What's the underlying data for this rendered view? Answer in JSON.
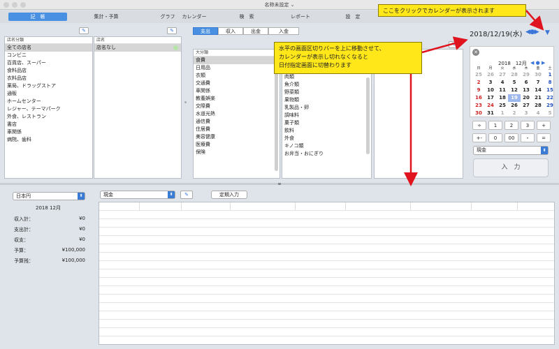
{
  "window": {
    "title": "名称未設定 ⌄"
  },
  "tabs": [
    {
      "label": "記　帳",
      "active": true
    },
    {
      "label": "集計・予算"
    },
    {
      "label": "グラフ"
    },
    {
      "label": "カレンダー"
    },
    {
      "label": "検　索"
    },
    {
      "label": "レポート"
    },
    {
      "label": "設　定"
    }
  ],
  "stores": {
    "header_left": "店名分類",
    "header_right": "店名",
    "categories": [
      "全ての店名",
      "コンビニ",
      "百貨店、スーパー",
      "食料品店",
      "衣料品店",
      "薬局、ドラッグストア",
      "通販",
      "ホームセンター",
      "レジャー、テーマパーク",
      "外食、レストラン",
      "書店",
      "車関係",
      "病院、歯科"
    ],
    "selected_store": "店名なし"
  },
  "entry_types": [
    "支出",
    "収入",
    "出金",
    "入金"
  ],
  "major": {
    "header": "大分類",
    "items": [
      "食費",
      "日用品",
      "衣類",
      "交通費",
      "車関係",
      "教養娯楽",
      "交際費",
      "水道光熱",
      "通信費",
      "住居費",
      "美容健康",
      "医療費",
      "保険"
    ]
  },
  "minor": {
    "items": [
      "肉類",
      "魚介類",
      "野菜類",
      "果物類",
      "乳製品・卵",
      "調味料",
      "菓子類",
      "飲料",
      "外食",
      "キノコ類",
      "お弁当・おにぎり"
    ]
  },
  "date": {
    "display": "2018/12/19(水)"
  },
  "calendar": {
    "year_month": "2018　12月",
    "weekdays": [
      "日",
      "月",
      "火",
      "水",
      "木",
      "金",
      "土"
    ],
    "weeks": [
      [
        "25",
        "26",
        "27",
        "28",
        "29",
        "30",
        "1"
      ],
      [
        "2",
        "3",
        "4",
        "5",
        "6",
        "7",
        "8"
      ],
      [
        "9",
        "10",
        "11",
        "12",
        "13",
        "14",
        "15"
      ],
      [
        "16",
        "17",
        "18",
        "19",
        "20",
        "21",
        "22"
      ],
      [
        "23",
        "24",
        "25",
        "26",
        "27",
        "28",
        "29"
      ],
      [
        "30",
        "31",
        "1",
        "2",
        "3",
        "4",
        "5"
      ]
    ]
  },
  "keypad": {
    "rows": [
      [
        "÷",
        "1",
        "2",
        "3",
        "+"
      ],
      [
        "+-",
        "0",
        "00",
        "・",
        "="
      ]
    ]
  },
  "payment": {
    "selected": "現金"
  },
  "input_button": "入　力",
  "bottom": {
    "currency": "日本円",
    "account": "現金",
    "fixed_button": "定期入力",
    "month": "2018 12月",
    "summary": [
      {
        "label": "収入計：",
        "value": "¥0"
      },
      {
        "label": "支出計：",
        "value": "¥0"
      },
      {
        "label": "収支：",
        "value": "¥0"
      },
      {
        "label": "予算：",
        "value": "¥100,000"
      },
      {
        "label": "予算残：",
        "value": "¥100,000"
      }
    ]
  },
  "callouts": {
    "top": "ここをクリックでカレンダーが表示されます",
    "middle": [
      "水平の画面区切りバーを上に移動させて、",
      "カレンダーが表示し切れなくなると",
      "日付指定画面に切替わります"
    ]
  },
  "colors": {
    "accent": "#4a90e2",
    "callout": "#ffe71a",
    "arrow": "#e0141e"
  }
}
